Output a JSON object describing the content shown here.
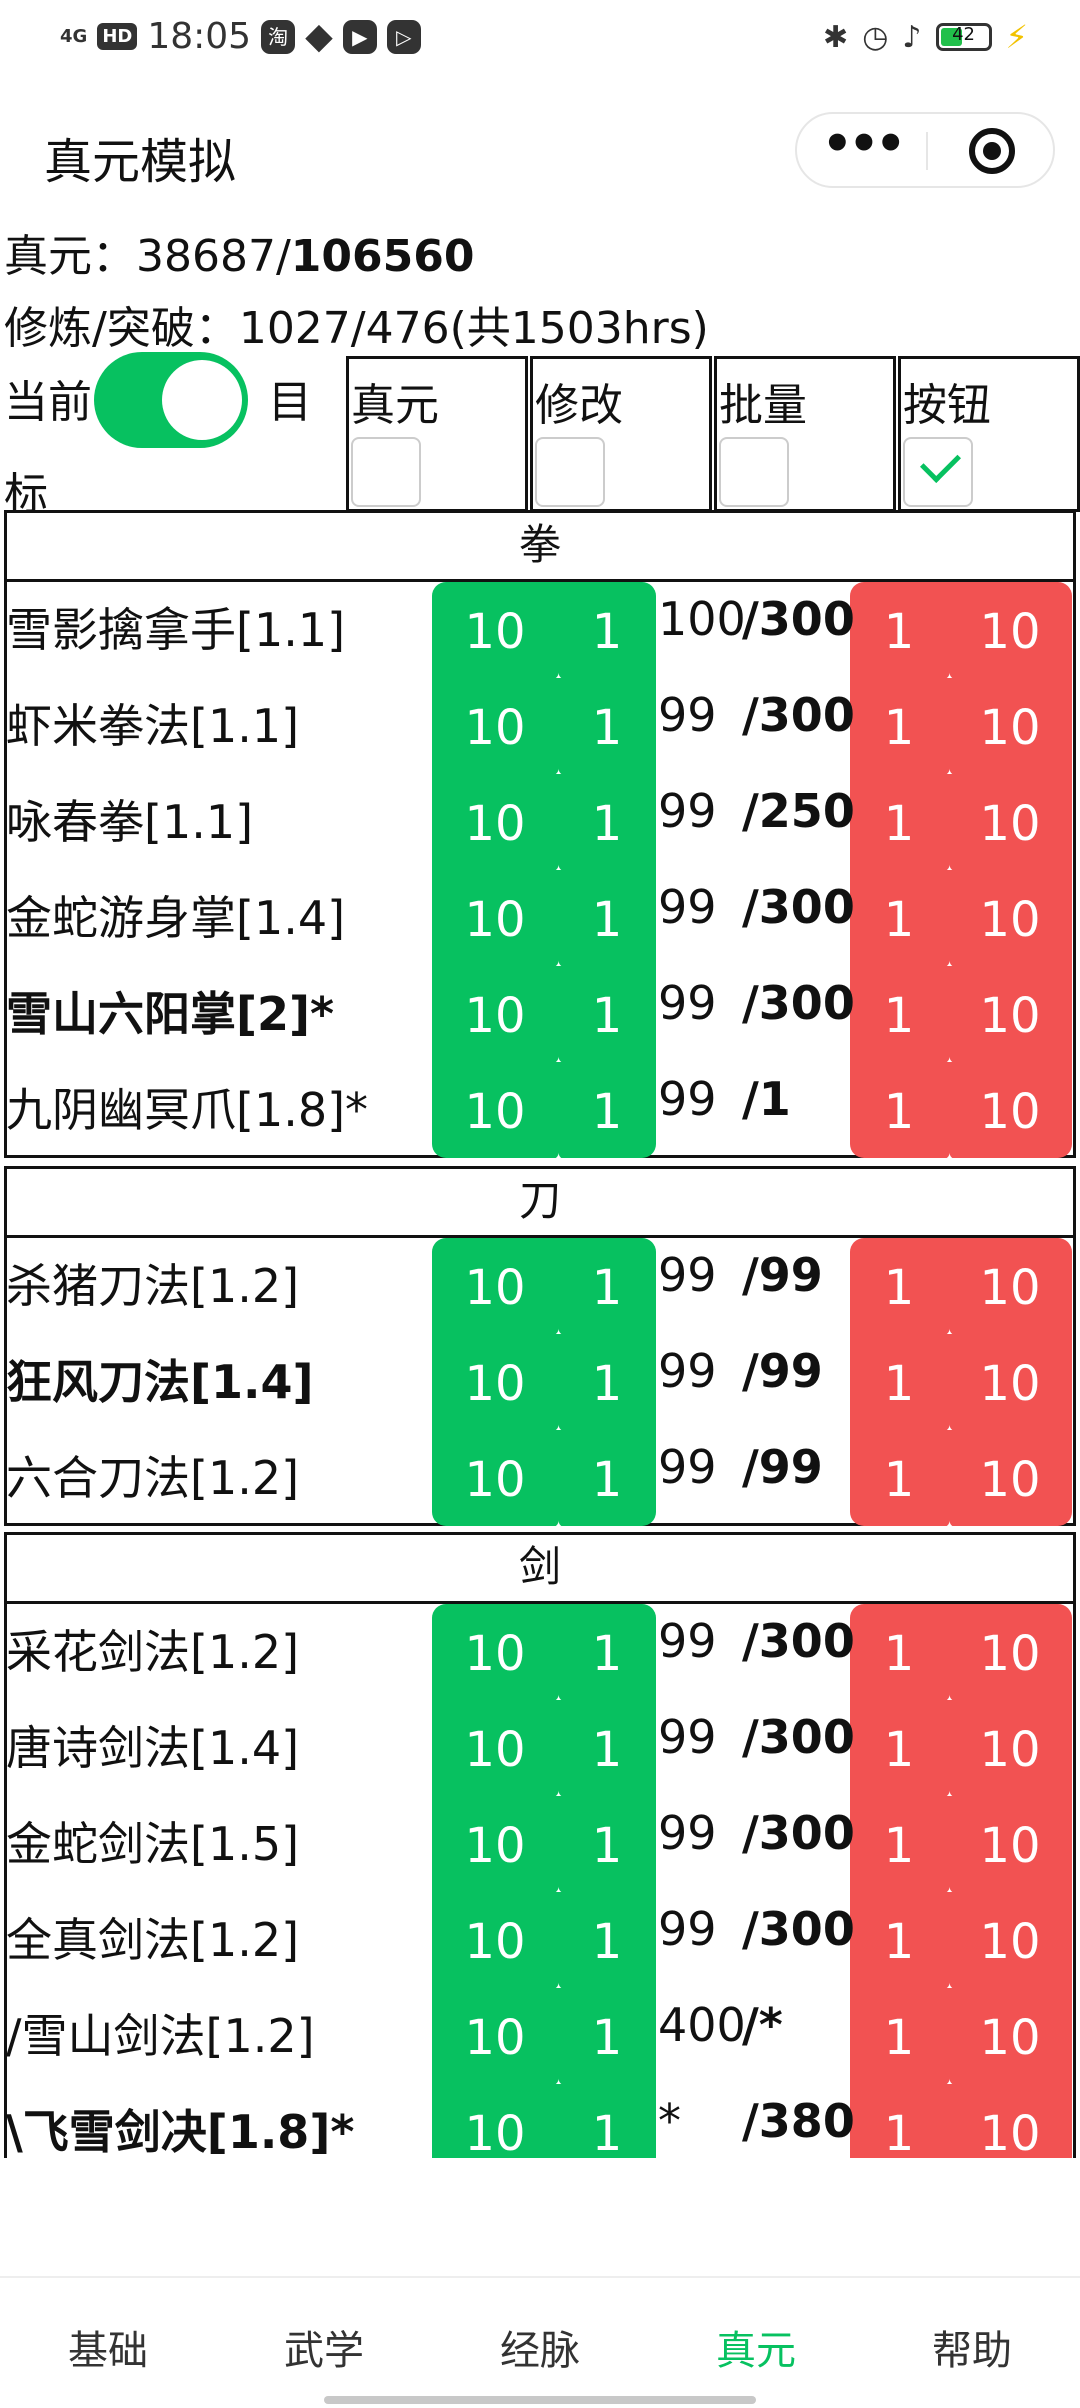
{
  "status": {
    "time": "18:05",
    "network": "4G",
    "hd": "HD",
    "battery": "42",
    "icons": [
      "taobao-icon",
      "qq-icon",
      "play-icon",
      "video-icon"
    ]
  },
  "header": {
    "title": "真元模拟"
  },
  "summary": {
    "zhenyuan_label": "真元：",
    "zhenyuan_current": "38687/",
    "zhenyuan_total": "106560",
    "train_text": "修炼/突破：1027/476(共1503hrs)"
  },
  "controls": {
    "left_label": "当前",
    "right_label": "目",
    "right_label2": "标",
    "toggle_on": true,
    "checkboxes": [
      {
        "label": "真元",
        "checked": false
      },
      {
        "label": "修改",
        "checked": false
      },
      {
        "label": "批量",
        "checked": false
      },
      {
        "label": "按钮",
        "checked": true
      }
    ]
  },
  "buttons": {
    "g1": "10",
    "g2": "1",
    "r1": "1",
    "r2": "10"
  },
  "categories": [
    {
      "name": "拳",
      "rows": [
        {
          "name": "雪影擒拿手[1.1]",
          "bold": false,
          "cur": "100",
          "max": "/300"
        },
        {
          "name": "虾米拳法[1.1]",
          "bold": false,
          "cur": "99",
          "max": "/300"
        },
        {
          "name": "咏春拳[1.1]",
          "bold": false,
          "cur": "99",
          "max": "/250"
        },
        {
          "name": "金蛇游身掌[1.4]",
          "bold": false,
          "cur": "99",
          "max": "/300"
        },
        {
          "name": "雪山六阳掌[2]*",
          "bold": true,
          "cur": "99",
          "max": "/300"
        },
        {
          "name": "九阴幽冥爪[1.8]*",
          "bold": false,
          "cur": "99",
          "max": "/1"
        }
      ]
    },
    {
      "name": "刀",
      "rows": [
        {
          "name": "杀猪刀法[1.2]",
          "bold": false,
          "cur": "99",
          "max": "/99"
        },
        {
          "name": "狂风刀法[1.4]",
          "bold": true,
          "cur": "99",
          "max": "/99"
        },
        {
          "name": "六合刀法[1.2]",
          "bold": false,
          "cur": "99",
          "max": "/99"
        }
      ]
    },
    {
      "name": "剑",
      "rows": [
        {
          "name": "采花剑法[1.2]",
          "bold": false,
          "cur": "99",
          "max": "/300"
        },
        {
          "name": "唐诗剑法[1.4]",
          "bold": false,
          "cur": "99",
          "max": "/300"
        },
        {
          "name": "金蛇剑法[1.5]",
          "bold": false,
          "cur": "99",
          "max": "/300"
        },
        {
          "name": "全真剑法[1.2]",
          "bold": false,
          "cur": "99",
          "max": "/300"
        },
        {
          "name": "/雪山剑法[1.2]",
          "bold": false,
          "cur": "400",
          "max": "/*"
        },
        {
          "name": "\\飞雪剑决[1.8]*",
          "bold": true,
          "cur": "*",
          "max": "/380"
        }
      ]
    }
  ],
  "tabs": [
    {
      "label": "基础",
      "active": false
    },
    {
      "label": "武学",
      "active": false
    },
    {
      "label": "经脉",
      "active": false
    },
    {
      "label": "真元",
      "active": true
    },
    {
      "label": "帮助",
      "active": false
    }
  ]
}
